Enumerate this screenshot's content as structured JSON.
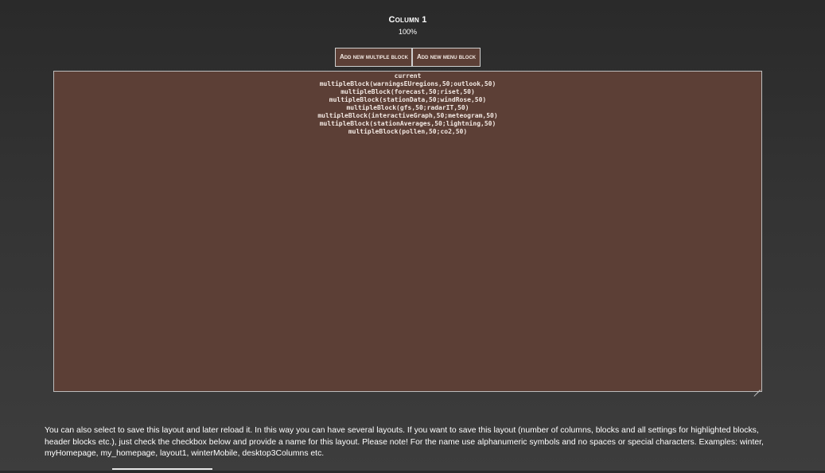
{
  "column": {
    "title": "Column 1",
    "width": "100%"
  },
  "buttons": {
    "add_multiple": "Add new multiple block",
    "add_menu": "Add new menu block"
  },
  "layout_textarea": {
    "lines": [
      "current",
      "multipleBlock(warningsEUregions,50;outlook,50)",
      "multipleBlock(forecast,50;riset,50)",
      "multipleBlock(stationData,50;windRose,50)",
      "multipleBlock(gfs,50;radarIT,50)",
      "multipleBlock(interactiveGraph,50;meteogram,50)",
      "multipleBlock(stationAverages,50;lightning,50)",
      "multipleBlock(pollen,50;co2,50)"
    ]
  },
  "save_info": {
    "text": "You can also select to save this layout and later reload it. In this way you can have several layouts. If you want to save this layout (number of columns, blocks and all settings for highlighted blocks, header blocks etc.), just check the checkbox below and provide a name for this layout. Please note! For the name use alphanumeric symbols and no spaces or special characters. Examples: winter, myHomepage, my_homepage, layout1, winterMobile, desktop3Columns etc."
  },
  "colors": {
    "background_top": "#2a2a2a",
    "background_bottom": "#3d3d3d",
    "accent_brown": "#5c3f36",
    "text": "#ffffff"
  }
}
